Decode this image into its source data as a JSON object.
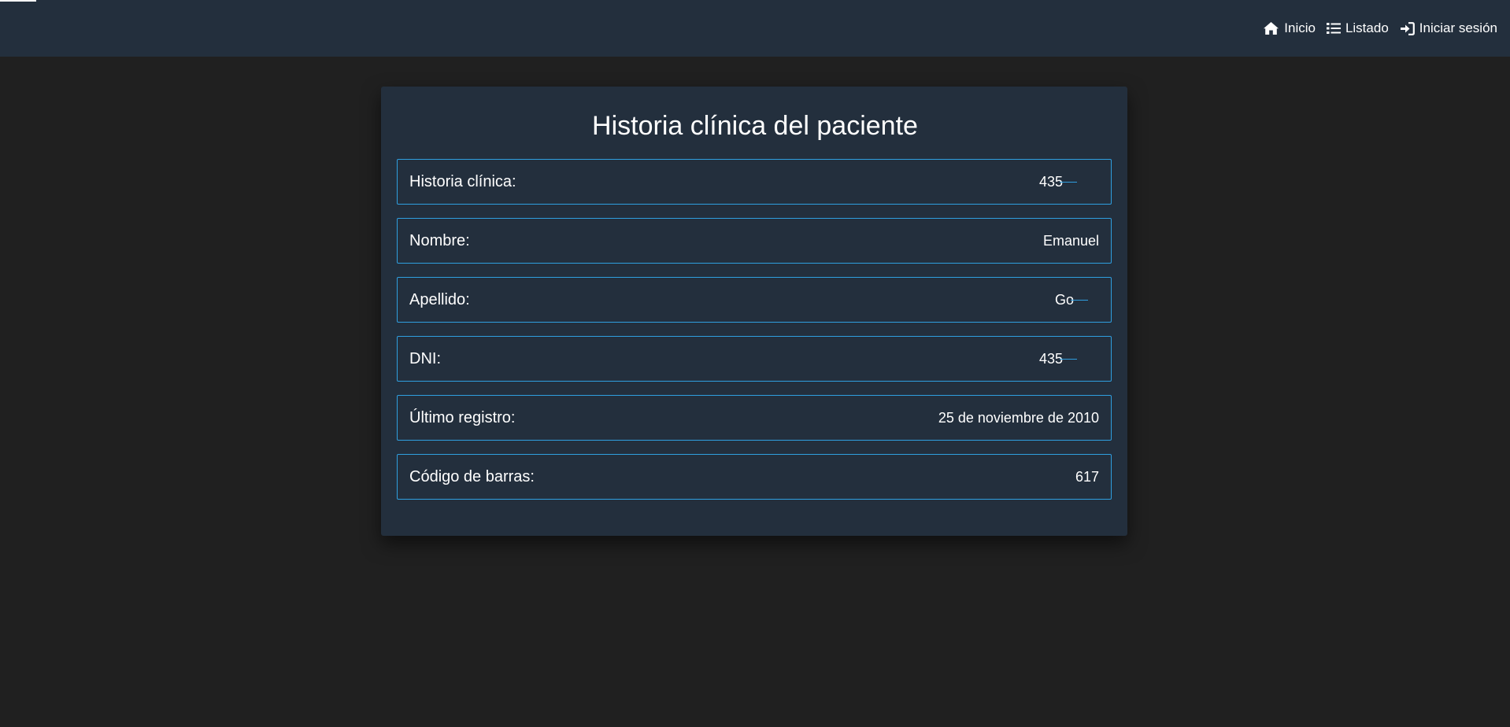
{
  "nav": {
    "items": [
      {
        "label": "Inicio",
        "icon": "home-icon"
      },
      {
        "label": "Listado",
        "icon": "list-icon"
      },
      {
        "label": "Iniciar sesión",
        "icon": "sign-in-icon"
      }
    ]
  },
  "colors": {
    "page_bg": "#202020",
    "bar_bg": "#232f3d",
    "card_bg": "#232f3d",
    "field_border": "#2f9fe0",
    "text": "#ffffff"
  },
  "card": {
    "title": "Historia clínica del paciente",
    "fields": [
      {
        "label": "Historia clínica:",
        "value": "435"
      },
      {
        "label": "Nombre:",
        "value": "Emanuel"
      },
      {
        "label": "Apellido:",
        "value": "Go"
      },
      {
        "label": "DNI:",
        "value": "435"
      },
      {
        "label": "Último registro:",
        "value": "25 de noviembre de 2010"
      },
      {
        "label": "Código de barras:",
        "value": "617"
      }
    ]
  }
}
